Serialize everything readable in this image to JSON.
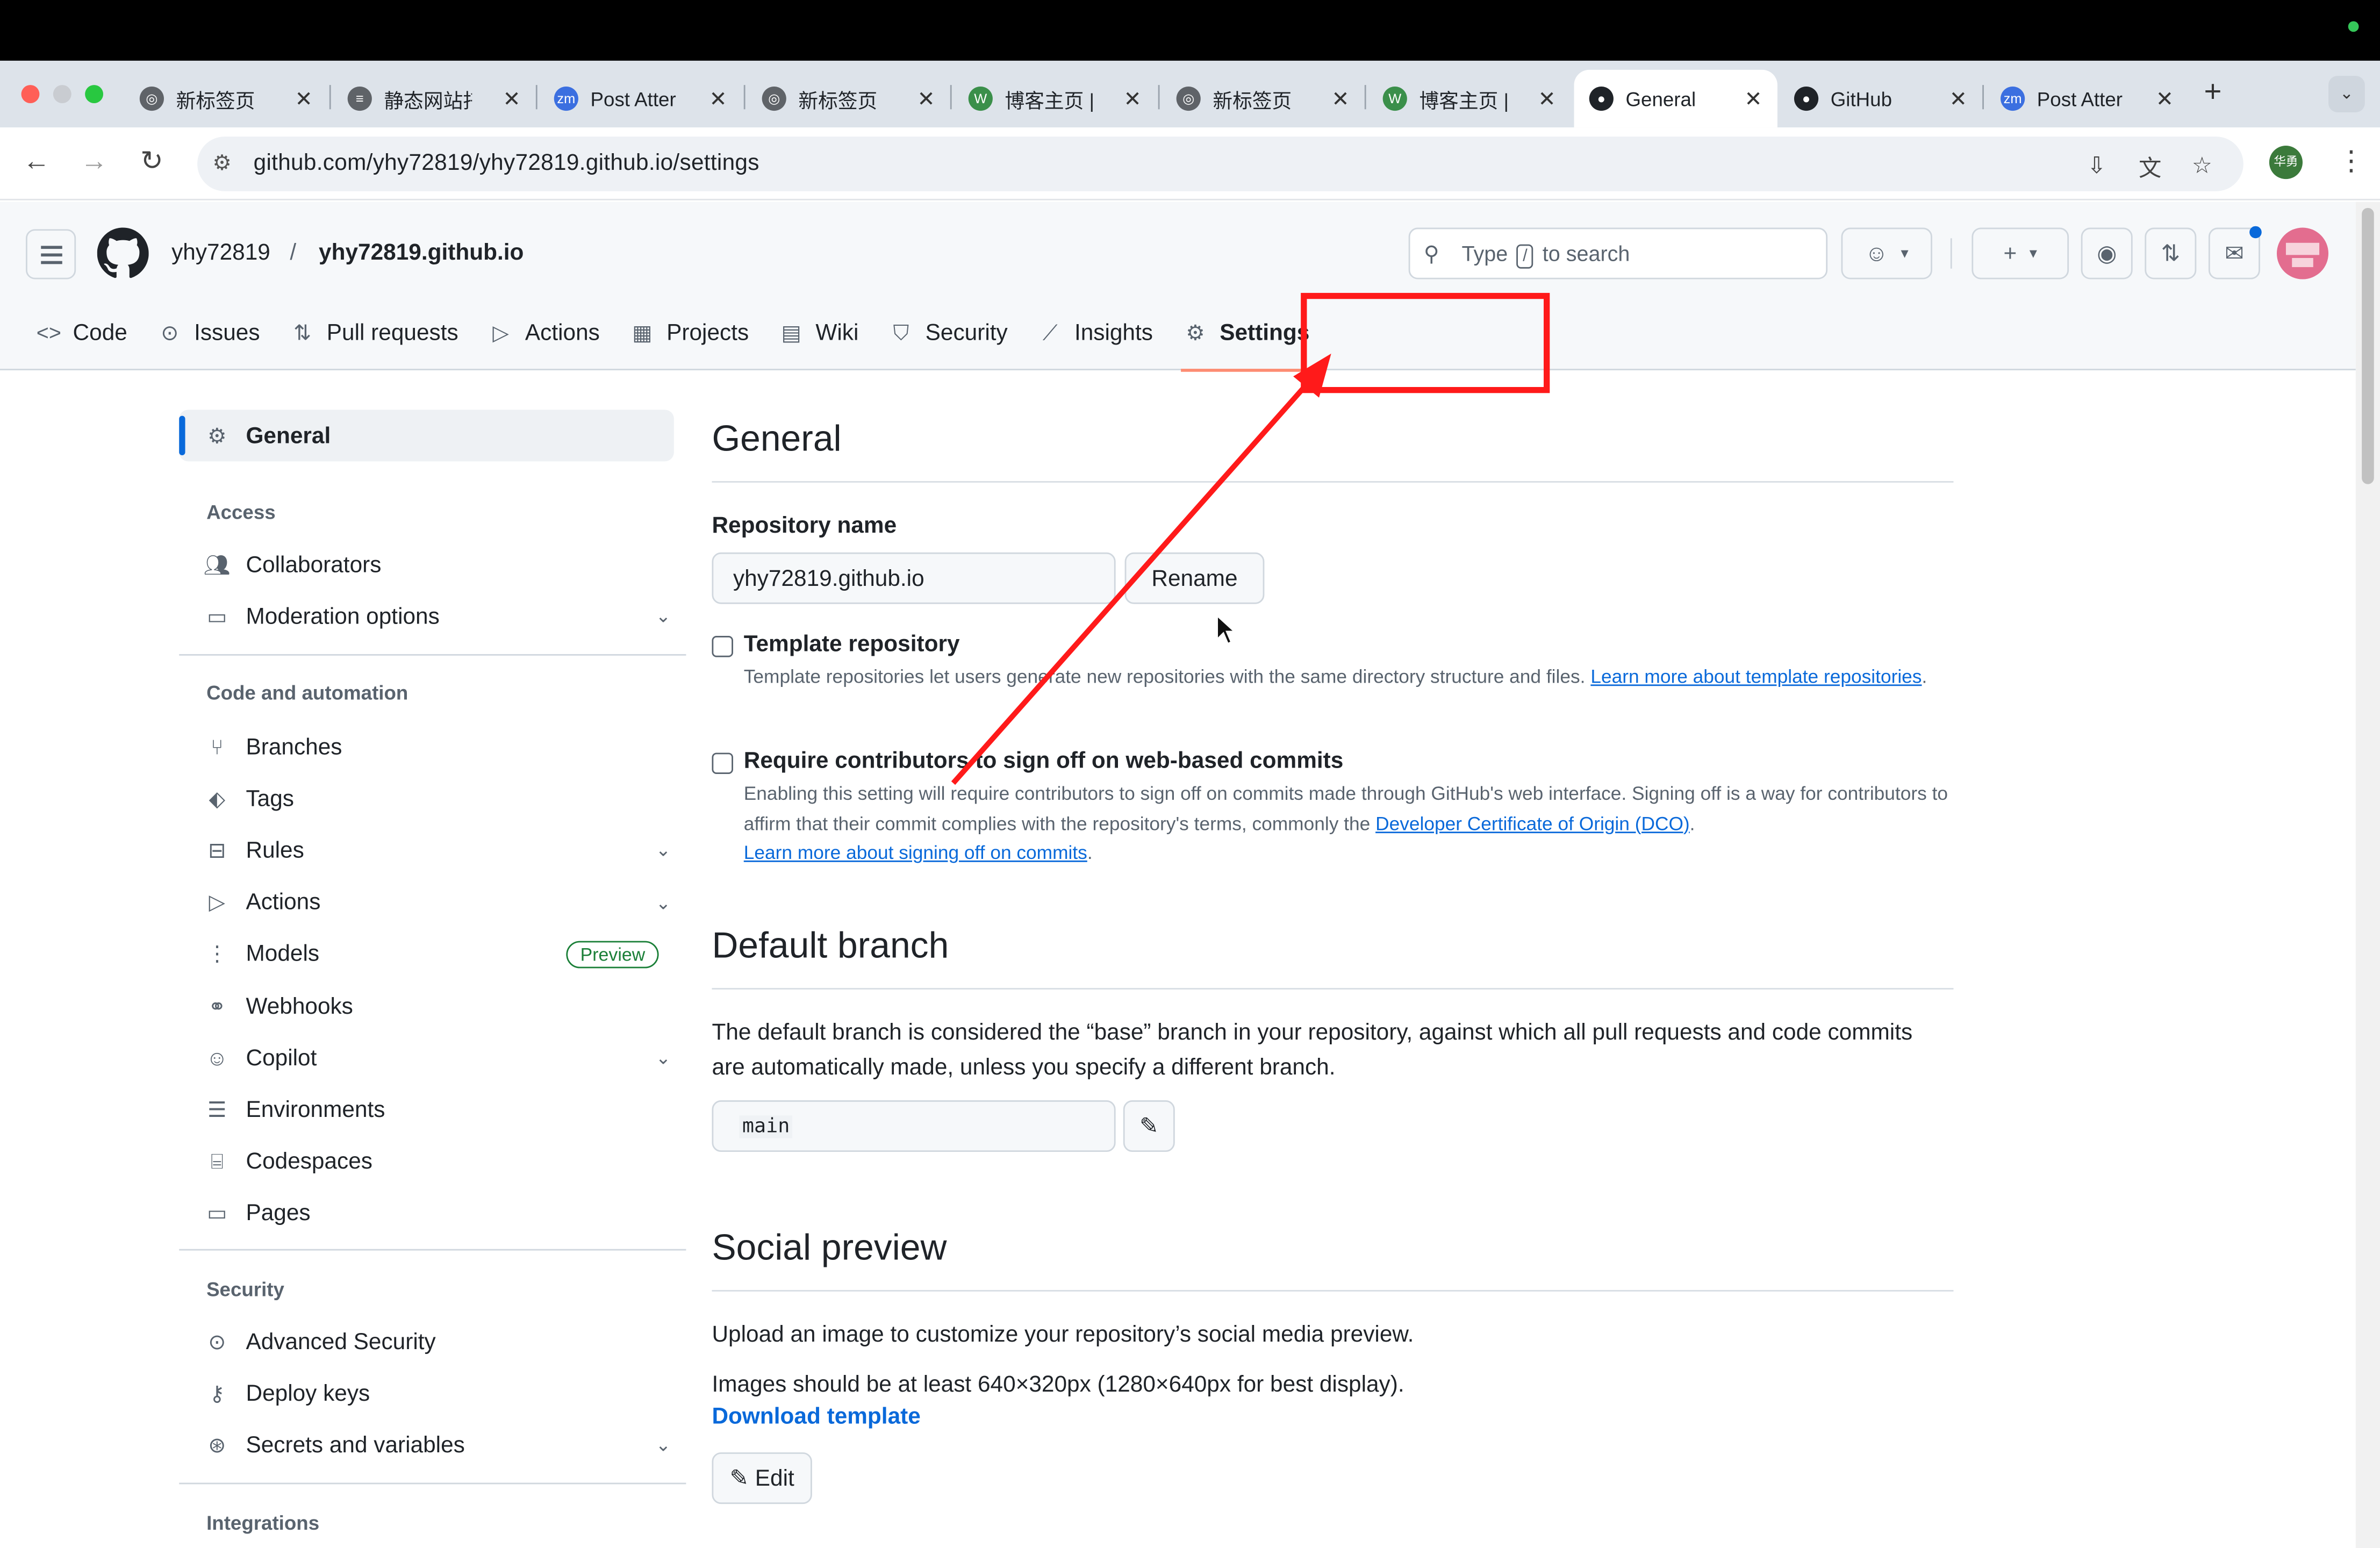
{
  "browser": {
    "tabs": [
      {
        "title": "新标签页",
        "icon": "chrome-icon",
        "color": "#5f6368"
      },
      {
        "title": "静态网站托",
        "icon": "doc-icon",
        "color": "#5f6368"
      },
      {
        "title": "Post Atter",
        "icon": "zm-icon",
        "color": "#3b6fe0"
      },
      {
        "title": "新标签页",
        "icon": "chrome-icon",
        "color": "#5f6368"
      },
      {
        "title": "博客主页 |",
        "icon": "blog-icon",
        "color": "#3a8f4a"
      },
      {
        "title": "新标签页",
        "icon": "chrome-icon",
        "color": "#5f6368"
      },
      {
        "title": "博客主页 |",
        "icon": "blog-icon",
        "color": "#3a8f4a"
      },
      {
        "title": "General",
        "icon": "github-icon",
        "color": "#1f2328"
      },
      {
        "title": "GitHub",
        "icon": "github-icon",
        "color": "#1f2328"
      },
      {
        "title": "Post Atter",
        "icon": "zm-icon",
        "color": "#3b6fe0"
      }
    ],
    "active_tab_index": 7,
    "url": "github.com/yhy72819/yhy72819.github.io/settings",
    "profile_label": "华勇"
  },
  "header": {
    "owner": "yhy72819",
    "repo": "yhy72819.github.io",
    "search_placeholder_pre": "Type",
    "search_kbd": "/",
    "search_placeholder_post": "to search"
  },
  "repo_nav": [
    {
      "label": "Code",
      "icon": "code-icon"
    },
    {
      "label": "Issues",
      "icon": "issue-icon"
    },
    {
      "label": "Pull requests",
      "icon": "pull-request-icon"
    },
    {
      "label": "Actions",
      "icon": "play-icon"
    },
    {
      "label": "Projects",
      "icon": "table-icon"
    },
    {
      "label": "Wiki",
      "icon": "book-icon"
    },
    {
      "label": "Security",
      "icon": "shield-icon"
    },
    {
      "label": "Insights",
      "icon": "graph-icon"
    },
    {
      "label": "Settings",
      "icon": "gear-icon",
      "selected": true
    }
  ],
  "sidebar": {
    "general": "General",
    "access_heading": "Access",
    "access": [
      "Collaborators",
      "Moderation options"
    ],
    "code_heading": "Code and automation",
    "code": [
      "Branches",
      "Tags",
      "Rules",
      "Actions",
      "Models",
      "Webhooks",
      "Copilot",
      "Environments",
      "Codespaces",
      "Pages"
    ],
    "models_badge": "Preview",
    "security_heading": "Security",
    "security": [
      "Advanced Security",
      "Deploy keys",
      "Secrets and variables"
    ],
    "integrations_heading": "Integrations"
  },
  "main": {
    "general_title": "General",
    "repo_name_label": "Repository name",
    "repo_name_value": "yhy72819.github.io",
    "rename_button": "Rename",
    "template_label": "Template repository",
    "template_note": "Template repositories let users generate new repositories with the same directory structure and files.",
    "template_link": "Learn more about template repositories",
    "signoff_label": "Require contributors to sign off on web-based commits",
    "signoff_note": "Enabling this setting will require contributors to sign off on commits made through GitHub's web interface. Signing off is a way for contributors to affirm that their commit complies with the repository's terms, commonly the",
    "signoff_link1": "Developer Certificate of Origin (DCO)",
    "signoff_link2": "Learn more about signing off on commits",
    "default_branch_title": "Default branch",
    "default_branch_text": "The default branch is considered the “base” branch in your repository, against which all pull requests and code commits are automatically made, unless you specify a different branch.",
    "default_branch_value": "main",
    "social_title": "Social preview",
    "social_text1": "Upload an image to customize your repository’s social media preview.",
    "social_text2": "Images should be at least 640×320px (1280×640px for best display).",
    "download_template": "Download template",
    "edit_button": "Edit"
  },
  "annotation": {
    "color": "#ff1a1a"
  }
}
